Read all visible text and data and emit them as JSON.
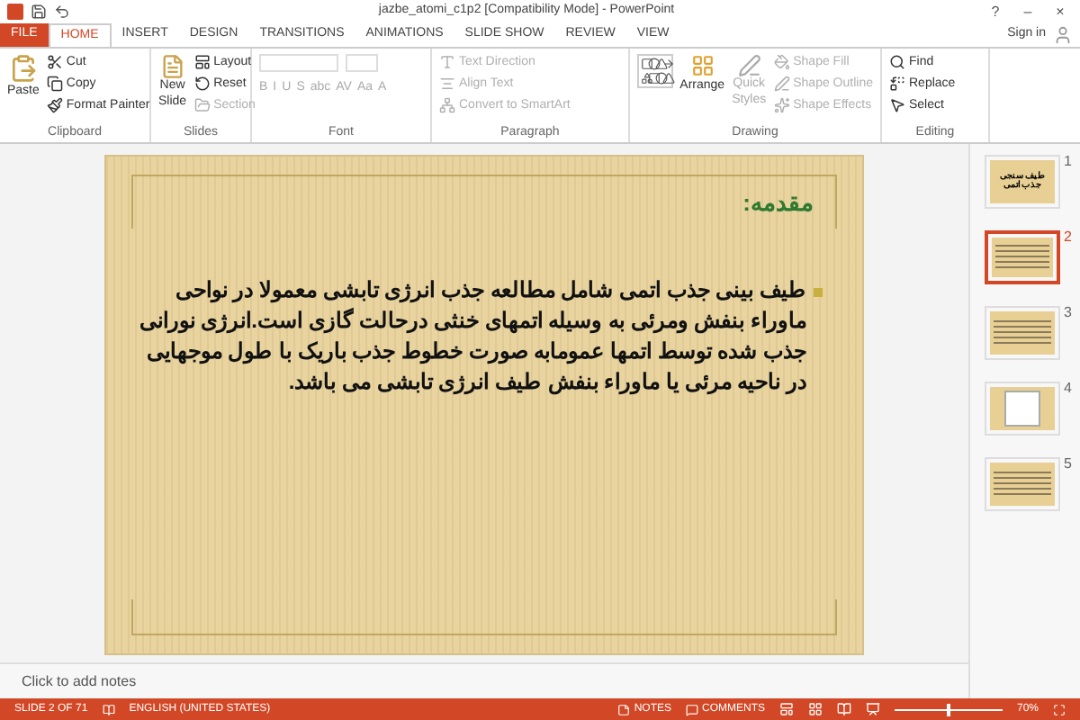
{
  "window": {
    "title": "jazbe_atomi_c1p2 [Compatibility Mode] - PowerPoint",
    "controls": [
      "?",
      "–",
      "×"
    ],
    "sign_in": "Sign in"
  },
  "tabs": [
    {
      "label": "FILE",
      "kind": "file",
      "selected": false
    },
    {
      "label": "HOME",
      "kind": "tab",
      "selected": true
    },
    {
      "label": "INSERT",
      "kind": "tab",
      "selected": false
    },
    {
      "label": "DESIGN",
      "kind": "tab",
      "selected": false
    },
    {
      "label": "TRANSITIONS",
      "kind": "tab",
      "selected": false
    },
    {
      "label": "ANIMATIONS",
      "kind": "tab",
      "selected": false
    },
    {
      "label": "SLIDE SHOW",
      "kind": "tab",
      "selected": false
    },
    {
      "label": "REVIEW",
      "kind": "tab",
      "selected": false
    },
    {
      "label": "VIEW",
      "kind": "tab",
      "selected": false
    }
  ],
  "ribbon": {
    "clipboard": {
      "label": "Clipboard",
      "paste": "Paste",
      "cut": "Cut",
      "copy": "Copy",
      "format_painter": "Format Painter"
    },
    "slides": {
      "label": "Slides",
      "new_slide": "New Slide",
      "items": [
        {
          "label": "Layout",
          "disabled": false
        },
        {
          "label": "Reset",
          "disabled": false
        },
        {
          "label": "Section",
          "disabled": true
        }
      ]
    },
    "font": {
      "label": "Font",
      "buttons": [
        "B",
        "I",
        "U",
        "S",
        "abc",
        "AV",
        "Aa",
        "A"
      ]
    },
    "paragraph": {
      "label": "Paragraph",
      "items": [
        {
          "label": "Text Direction",
          "disabled": true
        },
        {
          "label": "Align Text",
          "disabled": true
        },
        {
          "label": "Convert to SmartArt",
          "disabled": true
        }
      ]
    },
    "drawing": {
      "label": "Drawing",
      "arrange": "Arrange",
      "quick_styles": "Quick Styles",
      "items": [
        {
          "label": "Shape Fill",
          "disabled": true
        },
        {
          "label": "Shape Outline",
          "disabled": true
        },
        {
          "label": "Shape Effects",
          "disabled": true
        }
      ]
    },
    "editing": {
      "label": "Editing",
      "items": [
        {
          "label": "Find",
          "disabled": false
        },
        {
          "label": "Replace",
          "disabled": false
        },
        {
          "label": "Select",
          "disabled": false
        }
      ]
    }
  },
  "slide": {
    "title": "مقدمه:",
    "body": "طیف بینی جذب اتمی شامل مطالعه جذب انرژی تابشی معمولا در نواحی ماوراء بنفش ومرئی  به وسیله اتمهای خنثی درحالت گازی است.انرژی نورانی جذب شده توسط اتمها عمومابه صورت خطوط جذب باریک با طول موجهایی در ناحیه مرئی یا ماوراء بنفش طیف انرژی تابشی می باشد."
  },
  "notes": {
    "placeholder": "Click to add notes"
  },
  "thumbnails": [
    {
      "number": "1",
      "selected": false,
      "kind": "title",
      "title": "طیف سنجی جذب اتمی"
    },
    {
      "number": "2",
      "selected": true,
      "kind": "text"
    },
    {
      "number": "3",
      "selected": false,
      "kind": "text"
    },
    {
      "number": "4",
      "selected": false,
      "kind": "figure"
    },
    {
      "number": "5",
      "selected": false,
      "kind": "text"
    }
  ],
  "status_bar": {
    "slide": "SLIDE 2 OF 71",
    "language": "ENGLISH (UNITED STATES)",
    "notes": "NOTES",
    "comments": "COMMENTS",
    "zoom": "70%",
    "zoom_slider": {
      "level": 0.5
    }
  }
}
